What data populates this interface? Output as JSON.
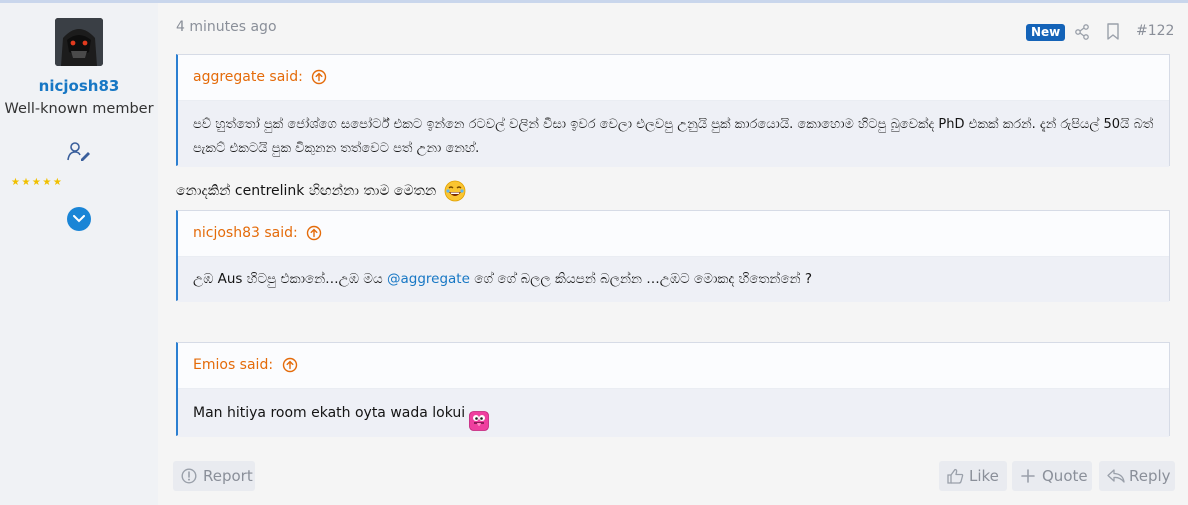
{
  "user": {
    "username": "nicjosh83",
    "title": "Well-known member",
    "stars": "★★★★★",
    "avatar_icon": "helmet-avatar",
    "edit_icon": "user-edit-icon",
    "expand_icon": "chevron-down-icon"
  },
  "post": {
    "time": "4 minutes ago",
    "new_label": "New",
    "number": "#122",
    "body_text": "නොදකින් centrelink හිඟන්නා තාම මෙතන",
    "body_emoji": "laughing-face-emoji"
  },
  "quotes": [
    {
      "author": "aggregate said:",
      "text": "පව් හුත්තෝ පුක් ජෝශ්ගෙ සපෝර්ට් එකට ඉන්නෙ රටවල් වලින් වීසා ඉවර වෙලා එලවපු උනුයි පුක් කාරයොයි. කොහොම හිටපු බුවෙක්ද PhD එකක් කරන්. දැන් රුපියල් 50යි බත් පැකට් එකටයි පුක විකුනන තත්වෙට පත් උනා නෙහ්."
    },
    {
      "author": "nicjosh83 said:",
      "text_before": "උඹ Aus හිටපු එකානේ…උඹ මය ",
      "mention": "@aggregate",
      "text_after": " ගේ ගේ බලල කියපන් බලන්න …උඹට මොකද හිතෙන්නේ ?"
    },
    {
      "author": "Emios said:",
      "text": "Man hitiya room ekath oyta wada lokui",
      "emoji": "tongue-out-emoji"
    }
  ],
  "footer": {
    "report": "Report",
    "like": "Like",
    "quote": "Quote",
    "reply": "Reply"
  },
  "colors": {
    "accent": "#1777c4",
    "quote_author": "#e46b0a",
    "badge": "#1463b8"
  }
}
